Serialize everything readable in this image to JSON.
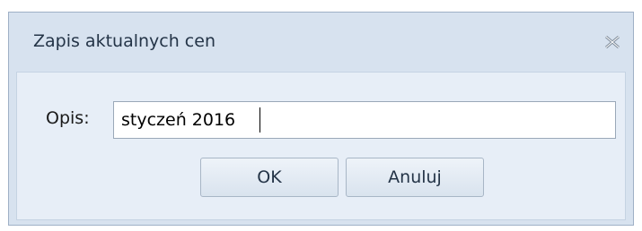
{
  "dialog": {
    "title": "Zapis aktualnych cen",
    "close_icon": "close-icon"
  },
  "form": {
    "opis_label": "Opis:",
    "opis_value": "styczeń 2016"
  },
  "buttons": {
    "ok_label": "OK",
    "cancel_label": "Anuluj"
  },
  "colors": {
    "dialog_background": "#d7e2ef",
    "content_background": "#e7eef7",
    "title_text": "#243447"
  }
}
